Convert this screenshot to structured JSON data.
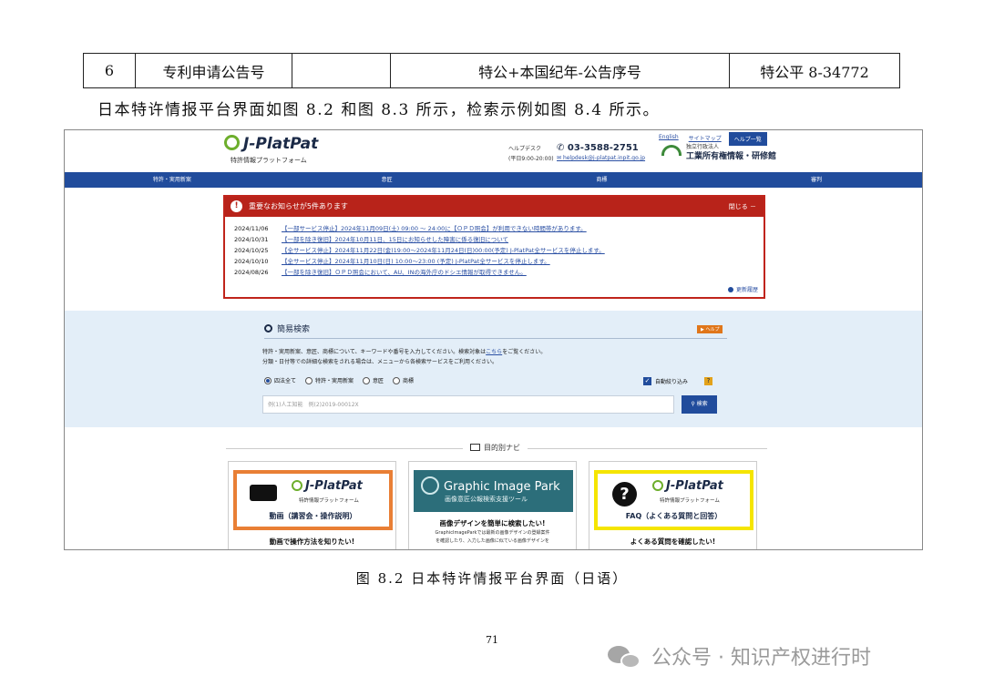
{
  "table": {
    "num": "6",
    "field": "专利申请公告号",
    "format": "特公+本国纪年-公告序号",
    "example": "特公平 8-34772"
  },
  "intro": "日本特许情报平台界面如图 8.2 和图 8.3 所示，检索示例如图 8.4 所示。",
  "screenshot": {
    "logo": "J-PlatPat",
    "logo_sub": "特許情報プラットフォーム",
    "helpdesk_label": "ヘルプデスク",
    "helpdesk_hours": "(平日9:00-20:00)",
    "phone": "03-3588-2751",
    "email": "helpdesk@j-platpat.inpit.go.jp",
    "links": {
      "english": "English",
      "sitemap": "サイトマップ",
      "help": "ヘルプ一覧"
    },
    "org_small": "独立行政法人",
    "org_name": "工業所有権情報・研修館",
    "nav": [
      "特許・実用新案",
      "意匠",
      "商標",
      "審判"
    ],
    "notice": {
      "title": "重要なお知らせが5件あります",
      "close": "閉じる －",
      "items": [
        {
          "date": "2024/11/06",
          "text": "【一部サービス停止】2024年11月09日(土) 09:00 ～ 24:00に【ＯＰＤ照会】が利用できない時間帯があります。"
        },
        {
          "date": "2024/10/31",
          "text": "【一部を除き復旧】2024年10月11日、15日にお知らせした障害に係る復旧について"
        },
        {
          "date": "2024/10/25",
          "text": "【全サービス停止】2024年11月22日(金)19:00～2024年11月24日(日)00:00(予定) J-PlatPat全サービスを停止します。"
        },
        {
          "date": "2024/10/10",
          "text": "【全サービス停止】2024年11月10日(日) 10:00～23:00 (予定) J-PlatPat全サービスを停止します。"
        },
        {
          "date": "2024/08/26",
          "text": "【一部を除き復旧】ＯＰＤ照会において、AU、INの海外庁のドシエ情報が取得できません。"
        }
      ],
      "more": "更新履歴"
    },
    "search": {
      "title": "簡易検索",
      "help": "ヘルプ",
      "desc1_pre": "特許・実用新案、意匠、商標について、キーワードや番号を入力してください。検索対象は",
      "desc1_link": "こちら",
      "desc1_post": "をご覧ください。",
      "desc2": "分類・日付等での詳細な検索をされる場合は、メニューから各検索サービスをご利用ください。",
      "options": [
        "四法全て",
        "特許・実用新案",
        "意匠",
        "商標"
      ],
      "auto": "自動絞り込み",
      "q": "?",
      "placeholder": "例(1)人工知能　例(2)2019-00012X",
      "button": "検索"
    },
    "navi_title": "目的別ナビ",
    "cards": [
      {
        "title": "動画（講習会・操作説明）",
        "caption": "動画で操作方法を知りたい!"
      },
      {
        "title": "Graphic Image Park",
        "subtitle": "画像意匠公報検索支援ツール",
        "caption": "画像デザインを簡単に検索したい!",
        "small1": "GraphicImageParkでは最新の画像デザインの登録案件",
        "small2": "を確認したり、入力した画像に似ている画像デザインを"
      },
      {
        "title": "FAQ（よくある質問と回答）",
        "caption": "よくある質問を確認したい!"
      }
    ]
  },
  "caption": "图 8.2  日本特许情报平台界面（日语）",
  "page_number": "71",
  "watermark": "公众号 · 知识产权进行时"
}
